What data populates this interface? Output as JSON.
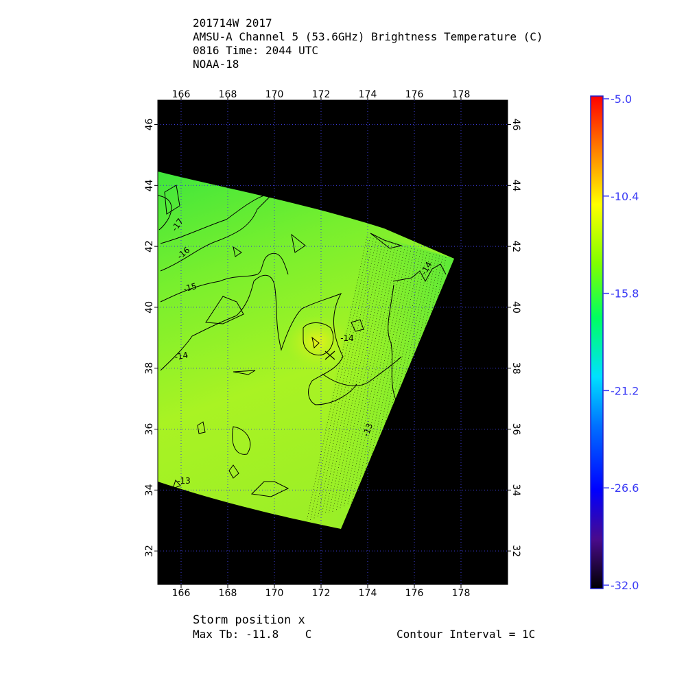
{
  "header": {
    "line1": "201714W 2017",
    "line2": "AMSU-A Channel 5 (53.6GHz) Brightness Temperature (C)",
    "line3": "0816 Time: 2044 UTC",
    "line4": "NOAA-18"
  },
  "map": {
    "lon_range": [
      165,
      180
    ],
    "lat_range": [
      30.9,
      46.8
    ],
    "lon_ticks": [
      "166",
      "168",
      "170",
      "172",
      "174",
      "176",
      "178"
    ],
    "lat_ticks": [
      "32",
      "34",
      "36",
      "38",
      "40",
      "42",
      "44",
      "46"
    ],
    "contour_labels": [
      "-17",
      "-16",
      "-15",
      "-14",
      "-14",
      "-14",
      "-13",
      "-13"
    ],
    "grid_color": "#3b3bd9",
    "background_color": "#000000"
  },
  "colorbar": {
    "tick_labels": [
      "-5.0",
      "-10.4",
      "-15.8",
      "-21.2",
      "-26.6",
      "-32.0"
    ],
    "range": [
      -32.0,
      -5.0
    ],
    "label_color": "#3a3af5"
  },
  "footer": {
    "storm_position": "Storm position x",
    "max_tb_label": "Max Tb: -11.8    C",
    "contour_interval": "Contour Interval = 1C"
  }
}
